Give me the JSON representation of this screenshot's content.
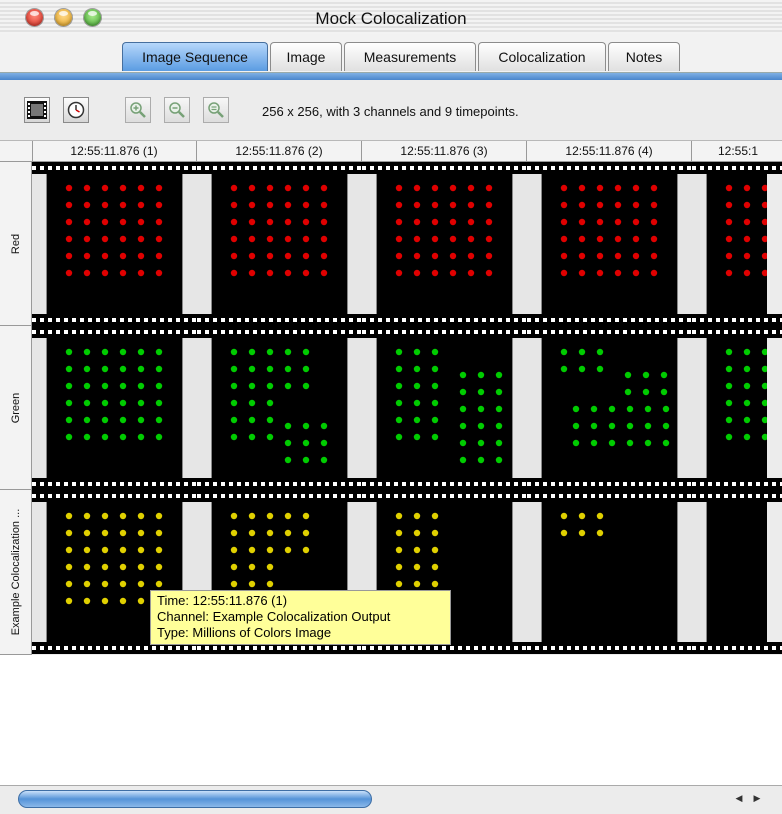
{
  "window": {
    "title": "Mock Colocalization"
  },
  "tabs": [
    {
      "label": "Image Sequence",
      "active": true
    },
    {
      "label": "Image",
      "active": false
    },
    {
      "label": "Measurements",
      "active": false
    },
    {
      "label": "Colocalization",
      "active": false
    },
    {
      "label": "Notes",
      "active": false
    }
  ],
  "toolbar": {
    "info": "256 x 256, with 3 channels and 9 timepoints.",
    "buttons": [
      {
        "icon": "film-icon"
      },
      {
        "icon": "clock-icon"
      },
      {
        "icon": "zoom-in-icon"
      },
      {
        "icon": "zoom-out-icon"
      },
      {
        "icon": "zoom-actual-icon"
      }
    ]
  },
  "columns": [
    "12:55:11.876 (1)",
    "12:55:11.876 (2)",
    "12:55:11.876 (3)",
    "12:55:11.876 (4)",
    "12:55:1"
  ],
  "rows": [
    {
      "label": "Red",
      "color": "#e00000"
    },
    {
      "label": "Green",
      "color": "#00cc00"
    },
    {
      "label": "Example Colocalization ...",
      "color": "#e0d000"
    }
  ],
  "tooltip": {
    "time": "Time: 12:55:11.876 (1)",
    "channel": "Channel: Example Colocalization Output",
    "type": "Type: Millions of Colors Image"
  },
  "colors": {
    "accent": "#5b9ce2",
    "tooltip_bg": "#ffff99"
  }
}
